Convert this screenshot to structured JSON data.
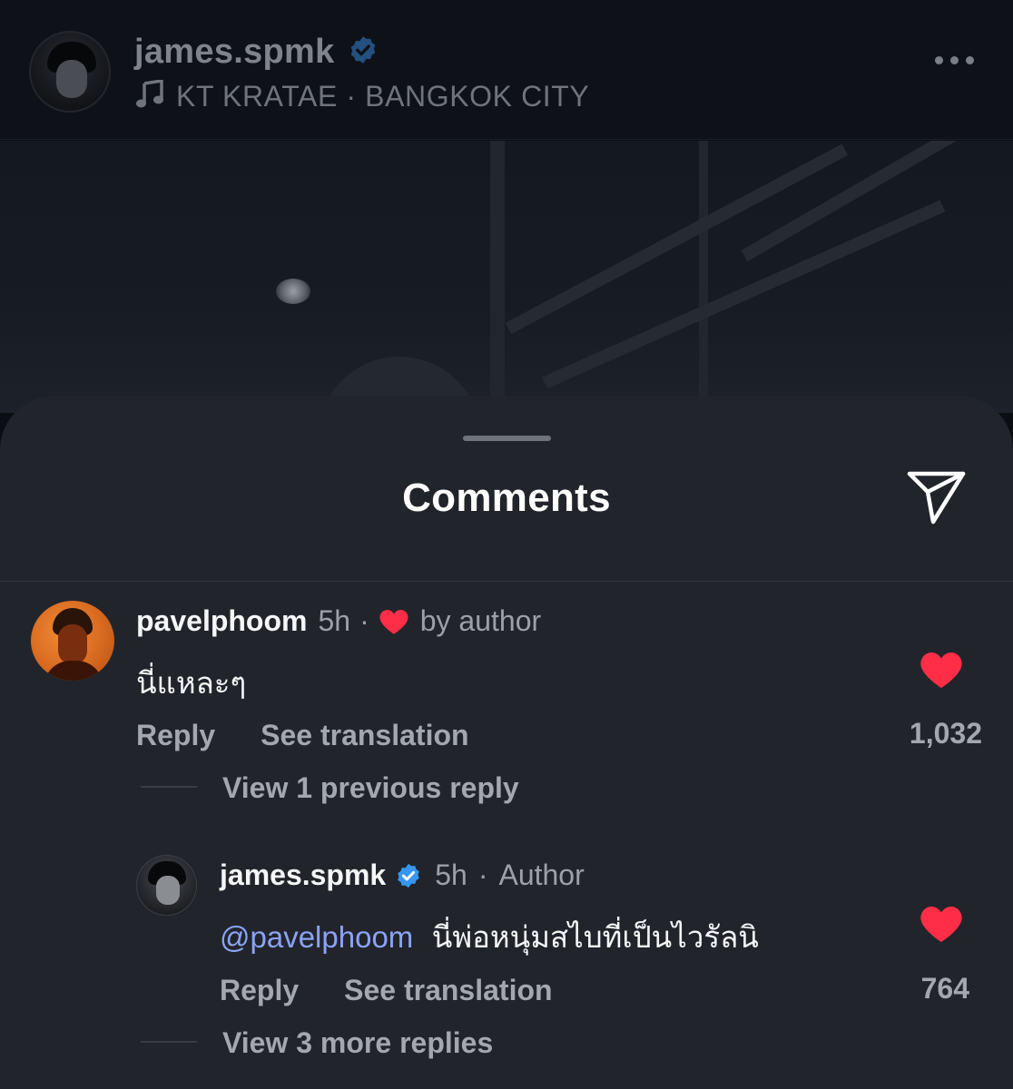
{
  "post": {
    "username": "james.spmk",
    "music": "KT KRATAE · BANGKOK CITY"
  },
  "sheet": {
    "title": "Comments"
  },
  "comments": [
    {
      "username": "pavelphoom",
      "time": "5h",
      "separator": "·",
      "liked_by": "by author",
      "text": "นี่แหละๆ",
      "reply_label": "Reply",
      "translate_label": "See translation",
      "like_count": "1,032",
      "view_replies": "View 1 previous reply"
    },
    {
      "username": "james.spmk",
      "time": "5h",
      "separator": "·",
      "badge": "Author",
      "mention": "@pavelphoom",
      "text": "นี่พ่อหนุ่มสไบที่เป็นไวรัลนิ",
      "reply_label": "Reply",
      "translate_label": "See translation",
      "like_count": "764",
      "view_replies": "View 3 more replies"
    }
  ],
  "colors": {
    "verified": "#3797f0",
    "heart": "#ff2d45",
    "mention": "#8aa3f5"
  },
  "icons": [
    "verified-badge-icon",
    "music-note-icon",
    "more-options-icon",
    "share-icon",
    "heart-icon"
  ]
}
